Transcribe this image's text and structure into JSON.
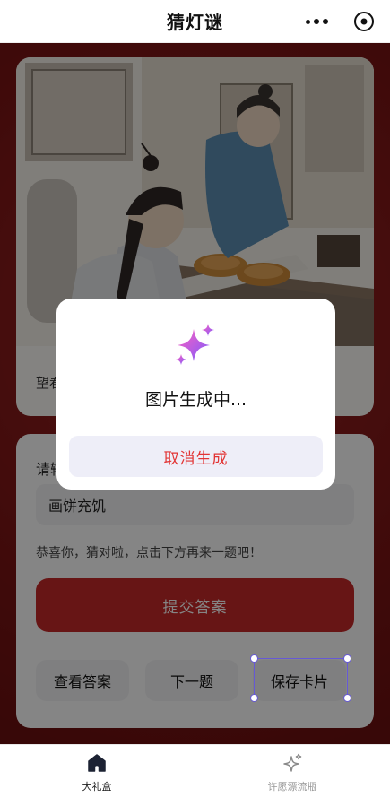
{
  "header": {
    "title": "猜灯谜"
  },
  "card": {
    "caption_partial": "望看"
  },
  "quiz": {
    "label_partial": "请输",
    "answer_value": "画饼充饥",
    "success_text": "恭喜你，猜对啦，点击下方再来一题吧！",
    "submit_label": "提交答案",
    "view_answer_label": "查看答案",
    "next_label": "下一题",
    "save_card_label": "保存卡片"
  },
  "modal": {
    "title": "图片生成中...",
    "cancel_label": "取消生成"
  },
  "tabbar": {
    "items": [
      {
        "label": "大礼盒",
        "active": true
      },
      {
        "label": "许愿漂流瓶",
        "active": false
      }
    ]
  },
  "colors": {
    "primary_red": "#c62a2a",
    "cancel_red": "#e23434",
    "selection": "#6659d6"
  },
  "icons": {
    "home": "home-icon",
    "wish": "sparkle-icon",
    "more": "more-dots-icon",
    "target": "target-icon"
  }
}
